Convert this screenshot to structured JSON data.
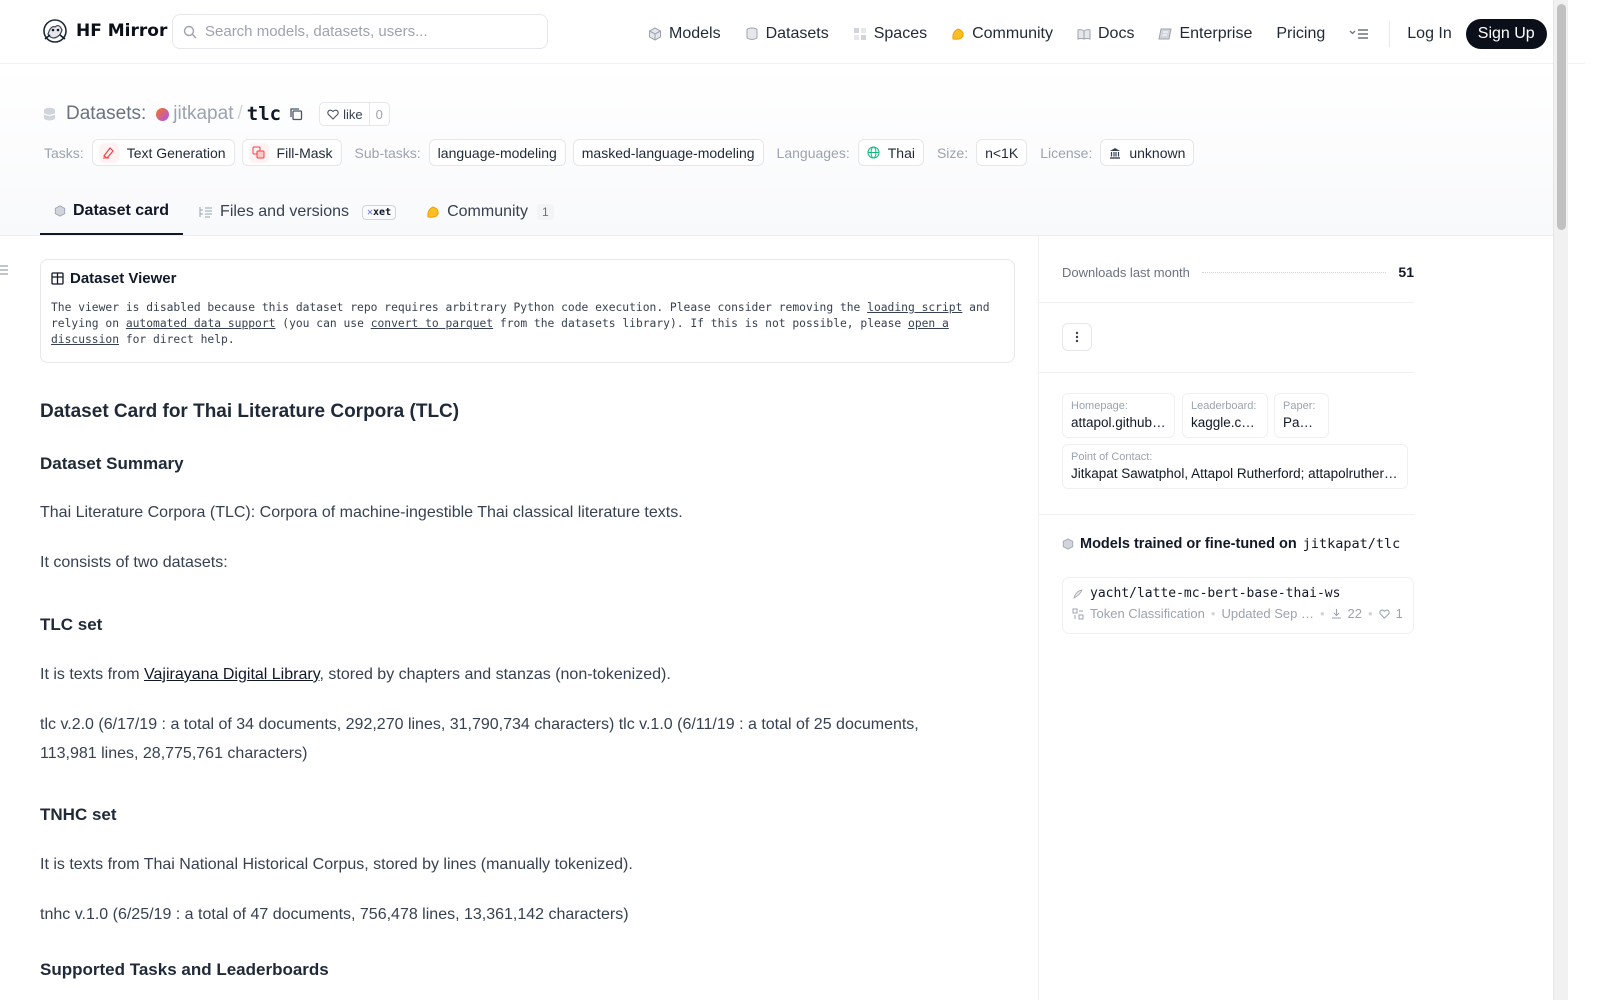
{
  "nav": {
    "brand": "HF Mirror",
    "search_placeholder": "Search models, datasets, users...",
    "links": [
      "Models",
      "Datasets",
      "Spaces",
      "Community",
      "Docs",
      "Enterprise",
      "Pricing"
    ],
    "login": "Log In",
    "signup": "Sign Up"
  },
  "header": {
    "section_label": "Datasets:",
    "owner": "jitkapat",
    "separator": "/",
    "repo": "tlc",
    "like_label": "like",
    "like_count": "0",
    "tags": {
      "tasks_label": "Tasks:",
      "tasks": [
        "Text Generation",
        "Fill-Mask"
      ],
      "subtasks_label": "Sub-tasks:",
      "subtasks": [
        "language-modeling",
        "masked-language-modeling"
      ],
      "languages_label": "Languages:",
      "languages": [
        "Thai"
      ],
      "size_label": "Size:",
      "size": "n<1K",
      "license_label": "License:",
      "license": "unknown"
    }
  },
  "tabs": {
    "dataset_card": "Dataset card",
    "files": "Files and versions",
    "xet": "xet",
    "community": "Community",
    "community_count": "1"
  },
  "viewer": {
    "title": "Dataset Viewer",
    "text_1": "The viewer is disabled because this dataset repo requires arbitrary Python code execution. Please consider removing the ",
    "link_1": "loading script",
    "text_2": " and relying on ",
    "link_2": "automated data support",
    "text_3": " (you can use ",
    "link_3": "convert to parquet",
    "text_4": " from the datasets library). If this is not possible, please ",
    "link_4": "open a discussion",
    "text_5": " for direct help."
  },
  "card": {
    "h1": "Dataset Card for Thai Literature Corpora (TLC)",
    "summary_h": "Dataset Summary",
    "summary_p": "Thai Literature Corpora (TLC): Corpora of machine-ingestible Thai classical literature texts.",
    "consists_p": "It consists of two datasets:",
    "tlc_h": "TLC set",
    "tlc_p_pre": "It is texts from ",
    "tlc_p_link": "Vajirayana Digital Library",
    "tlc_p_post": ", stored by chapters and stanzas (non-tokenized).",
    "tlc_versions": "tlc v.2.0 (6/17/19 : a total of 34 documents, 292,270 lines, 31,790,734 characters) tlc v.1.0 (6/11/19 : a total of 25 documents, 113,981 lines, 28,775,761 characters)",
    "tnhc_h": "TNHC set",
    "tnhc_p": "It is texts from Thai National Historical Corpus, stored by lines (manually tokenized).",
    "tnhc_versions": "tnhc v.1.0 (6/25/19 : a total of 47 documents, 756,478 lines, 13,361,142 characters)",
    "supported_h": "Supported Tasks and Leaderboards"
  },
  "sidebar": {
    "downloads_label": "Downloads last month",
    "downloads": "51",
    "homepage_k": "Homepage:",
    "homepage_v": "attapol.github.io",
    "leaderboard_k": "Leaderboard:",
    "leaderboard_v": "kaggle.com",
    "paper_k": "Paper:",
    "paper_v": "Paper:",
    "contact_k": "Point of Contact:",
    "contact_v": "Jitkapat Sawatphol, Attapol Rutherford; attapolrutherford@gmail.com",
    "models_hdr": "Models trained or fine-tuned on",
    "models_repo": "jitkapat/tlc",
    "model_name": "yacht/latte-mc-bert-base-thai-ws",
    "model_task": "Token Classification",
    "model_updated": "Updated Sep …",
    "model_downloads": "22",
    "model_likes": "1"
  }
}
